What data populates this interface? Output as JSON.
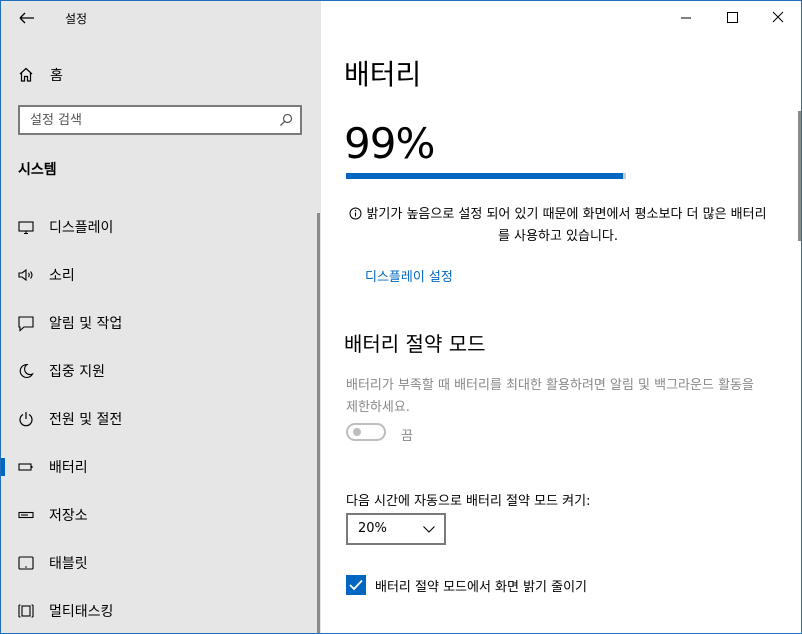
{
  "app": {
    "title": "설정"
  },
  "sidebar": {
    "home_label": "홈",
    "search_placeholder": "설정 검색",
    "section_title": "시스템",
    "items": [
      {
        "label": "디스플레이",
        "icon": "display-icon"
      },
      {
        "label": "소리",
        "icon": "sound-icon"
      },
      {
        "label": "알림 및 작업",
        "icon": "notifications-icon"
      },
      {
        "label": "집중 지원",
        "icon": "moon-icon"
      },
      {
        "label": "전원 및 절전",
        "icon": "power-icon"
      },
      {
        "label": "배터리",
        "icon": "battery-icon",
        "active": true
      },
      {
        "label": "저장소",
        "icon": "storage-icon"
      },
      {
        "label": "태블릿",
        "icon": "tablet-icon"
      },
      {
        "label": "멀티태스킹",
        "icon": "multitasking-icon"
      }
    ]
  },
  "main": {
    "title": "배터리",
    "battery_percent": "99%",
    "battery_level": 0.99,
    "info_text": "밝기가 높음으로 설정 되어 있기 때문에 화면에서 평소보다 더 많은 배터리를 사용하고 있습니다.",
    "display_settings_link": "디스플레이 설정",
    "saver_title": "배터리 절약 모드",
    "saver_desc": "배터리가 부족할 때 배터리를 최대한 활용하려면 알림 및 백그라운드 활동을 제한하세요.",
    "saver_toggle_label": "끔",
    "auto_label": "다음 시간에 자동으로 배터리 절약 모드 켜기:",
    "auto_value": "20%",
    "brightness_label": "배터리 절약 모드에서 화면 밝기 줄이기"
  },
  "colors": {
    "accent": "#0067c0",
    "sidebar_bg": "#e6e6e6"
  }
}
